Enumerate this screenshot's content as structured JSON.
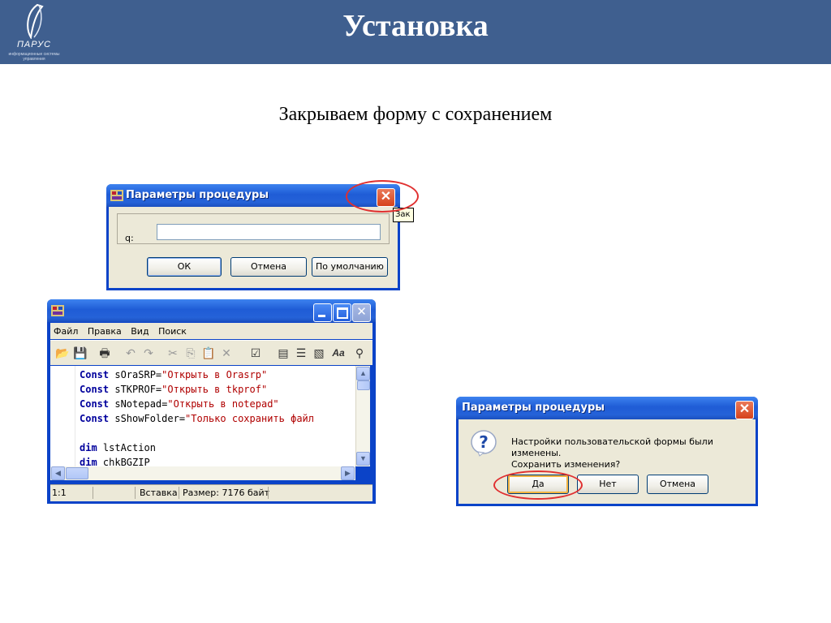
{
  "slide": {
    "title": "Установка",
    "subtitle": "Закрываем форму с сохранением"
  },
  "logo": {
    "name": "ПАРУС",
    "tagline": "информационные системы управления"
  },
  "dialog_params": {
    "title": "Параметры процедуры",
    "field_label": "q:",
    "field_value": "",
    "ok_label": "ОК",
    "cancel_label": "Отмена",
    "default_label": "По умолчанию",
    "close_tooltip": "Зак"
  },
  "editor": {
    "menu": [
      "Файл",
      "Правка",
      "Вид",
      "Поиск"
    ],
    "status_position": "1:1",
    "status_mode": "Вставка",
    "status_size": "Размер: 7176 байт"
  },
  "dialog_save": {
    "title": "Параметры процедуры",
    "message_line1": "Настройки пользовательской формы были изменены.",
    "message_line2": "Сохранить изменения?",
    "yes_label": "Да",
    "no_label": "Нет",
    "cancel_label": "Отмена"
  },
  "code_lines": [
    {
      "kw": "Const",
      "id": " sOraSRP=",
      "str": "\"Открыть в Orasrp\""
    },
    {
      "kw": "Const",
      "id": " sTKPROF=",
      "str": "\"Открыть в tkprof\""
    },
    {
      "kw": "Const",
      "id": " sNotepad=",
      "str": "\"Открыть в notepad\""
    },
    {
      "kw": "Const",
      "id": " sShowFolder=",
      "str": "\"Только сохранить файл"
    },
    {
      "kw": "",
      "id": "",
      "str": ""
    },
    {
      "kw": "dim",
      "id": " lstAction",
      "str": ""
    },
    {
      "kw": "dim",
      "id": " chkBGZIP",
      "str": ""
    }
  ],
  "colors": {
    "header_bg": "#3f5f8f",
    "xp_title": "#2562d8",
    "highlight_ring": "#e03030"
  }
}
